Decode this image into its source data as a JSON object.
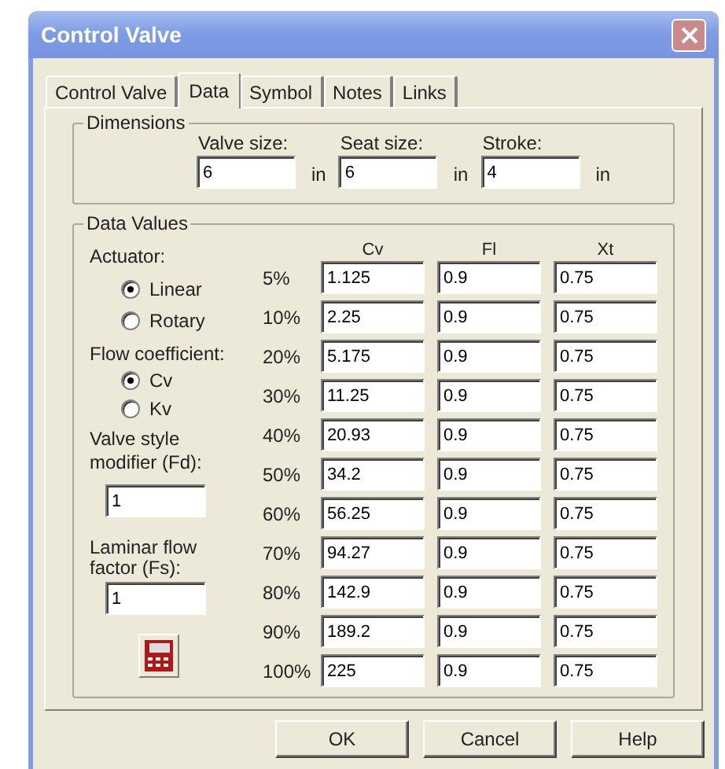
{
  "window": {
    "title": "Control Valve"
  },
  "tabs": [
    {
      "label": "Control Valve",
      "selected": false
    },
    {
      "label": "Data",
      "selected": true
    },
    {
      "label": "Symbol",
      "selected": false
    },
    {
      "label": "Notes",
      "selected": false
    },
    {
      "label": "Links",
      "selected": false
    }
  ],
  "dimensions": {
    "title": "Dimensions",
    "fields": [
      {
        "label": "Valve size:",
        "value": "6",
        "unit": "in"
      },
      {
        "label": "Seat size:",
        "value": "6",
        "unit": "in"
      },
      {
        "label": "Stroke:",
        "value": "4",
        "unit": "in"
      }
    ]
  },
  "data_values": {
    "title": "Data Values",
    "actuator": {
      "label": "Actuator:",
      "options": [
        {
          "label": "Linear",
          "selected": true
        },
        {
          "label": "Rotary",
          "selected": false
        }
      ]
    },
    "flow_coefficient": {
      "label": "Flow coefficient:",
      "options": [
        {
          "label": "Cv",
          "selected": true
        },
        {
          "label": "Kv",
          "selected": false
        }
      ]
    },
    "valve_style_modifier": {
      "label": "Valve style\nmodifier  (Fd):",
      "value": "1"
    },
    "laminar_flow_factor": {
      "label": "Laminar flow\nfactor  (Fs):",
      "value": "1"
    },
    "columns": [
      "Cv",
      "Fl",
      "Xt"
    ],
    "rows": [
      {
        "label": "5%",
        "values": [
          "1.125",
          "0.9",
          "0.75"
        ]
      },
      {
        "label": "10%",
        "values": [
          "2.25",
          "0.9",
          "0.75"
        ]
      },
      {
        "label": "20%",
        "values": [
          "5.175",
          "0.9",
          "0.75"
        ]
      },
      {
        "label": "30%",
        "values": [
          "11.25",
          "0.9",
          "0.75"
        ]
      },
      {
        "label": "40%",
        "values": [
          "20.93",
          "0.9",
          "0.75"
        ]
      },
      {
        "label": "50%",
        "values": [
          "34.2",
          "0.9",
          "0.75"
        ]
      },
      {
        "label": "60%",
        "values": [
          "56.25",
          "0.9",
          "0.75"
        ]
      },
      {
        "label": "70%",
        "values": [
          "94.27",
          "0.9",
          "0.75"
        ]
      },
      {
        "label": "80%",
        "values": [
          "142.9",
          "0.9",
          "0.75"
        ]
      },
      {
        "label": "90%",
        "values": [
          "189.2",
          "0.9",
          "0.75"
        ]
      },
      {
        "label": "100%",
        "values": [
          "225",
          "0.9",
          "0.75"
        ]
      }
    ]
  },
  "buttons": [
    "OK",
    "Cancel",
    "Help"
  ]
}
